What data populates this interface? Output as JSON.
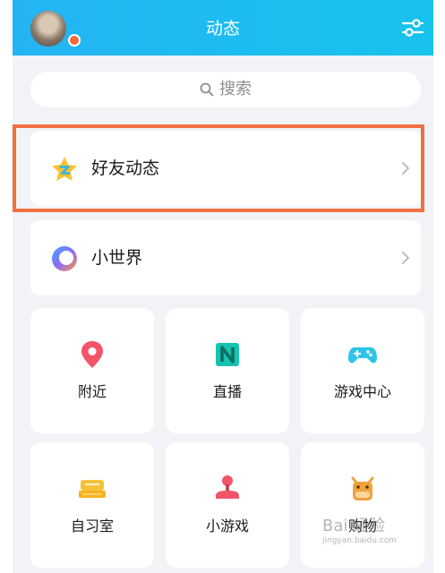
{
  "header": {
    "title": "动态",
    "avatar_icon": "avatar",
    "settings_icon": "settings-sliders-icon",
    "gradient": [
      "#24b4f4",
      "#17c3ec"
    ]
  },
  "search": {
    "placeholder": "搜索",
    "icon": "search-icon"
  },
  "rows": [
    {
      "label": "好友动态",
      "icon": "qzone-star-icon",
      "chevron": "chevron-right-icon",
      "highlighted": true
    },
    {
      "label": "小世界",
      "icon": "small-world-icon",
      "chevron": "chevron-right-icon",
      "highlighted": false
    }
  ],
  "grid": [
    {
      "label": "附近",
      "icon": "location-pin-icon",
      "color": "#f2556a"
    },
    {
      "label": "直播",
      "icon": "live-n-icon",
      "color": "#15c4b0"
    },
    {
      "label": "游戏中心",
      "icon": "gamepad-icon",
      "color": "#2ec3e8"
    },
    {
      "label": "自习室",
      "icon": "study-room-icon",
      "color": "#f6c23c"
    },
    {
      "label": "小游戏",
      "icon": "joystick-icon",
      "color": "#f2556a"
    },
    {
      "label": "购物",
      "icon": "shopping-cow-icon",
      "color": "#f0a23c"
    }
  ],
  "highlight_color": "#f07040",
  "watermark": {
    "text": "Bai 经验",
    "sub": "jingyan.baidu.com"
  }
}
